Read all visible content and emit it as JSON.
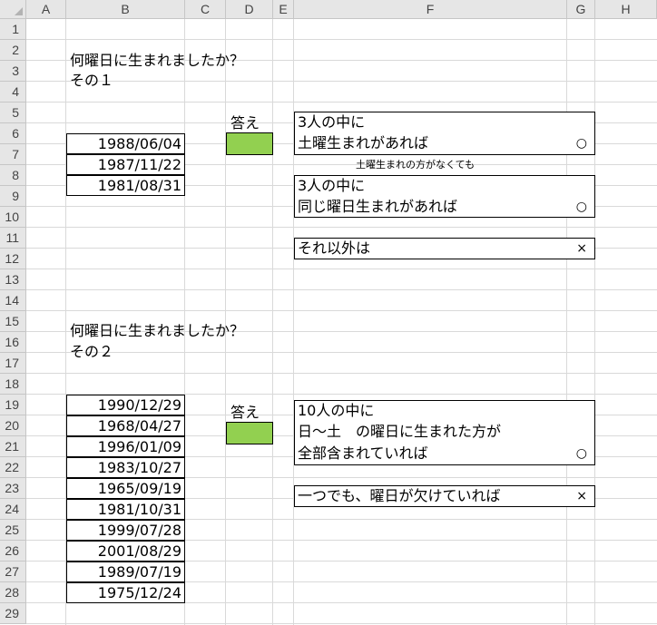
{
  "columns": [
    {
      "label": "A"
    },
    {
      "label": "B"
    },
    {
      "label": "C"
    },
    {
      "label": "D"
    },
    {
      "label": "E"
    },
    {
      "label": "F"
    },
    {
      "label": "G"
    },
    {
      "label": "H"
    }
  ],
  "rows": [
    "1",
    "2",
    "3",
    "4",
    "5",
    "6",
    "7",
    "8",
    "9",
    "10",
    "11",
    "12",
    "13",
    "14",
    "15",
    "16",
    "17",
    "18",
    "19",
    "20",
    "21",
    "22",
    "23",
    "24",
    "25",
    "26",
    "27",
    "28",
    "29"
  ],
  "section1": {
    "title": "何曜日に生まれましたか？",
    "subtitle": "その１",
    "answer_label": "答え",
    "dates": [
      "1988/06/04",
      "1987/11/22",
      "1981/08/31"
    ],
    "rule1": {
      "line1": "3人の中に",
      "line2": "土曜生まれがあれば",
      "mark": "○"
    },
    "note": "土曜生まれの方がなくても",
    "rule2": {
      "line1": "3人の中に",
      "line2": "同じ曜日生まれがあれば",
      "mark": "○"
    },
    "rule3": {
      "line1": "それ以外は",
      "mark": "×"
    }
  },
  "section2": {
    "title": "何曜日に生まれましたか？",
    "subtitle": "その２",
    "answer_label": "答え",
    "dates": [
      "1990/12/29",
      "1968/04/27",
      "1996/01/09",
      "1983/10/27",
      "1965/09/19",
      "1981/10/31",
      "1999/07/28",
      "2001/08/29",
      "1989/07/19",
      "1975/12/24"
    ],
    "rule1": {
      "line1": "10人の中に",
      "line2": "日～土　の曜日に生まれた方が",
      "line3": "全部含まれていれば",
      "mark": "○"
    },
    "rule2": {
      "line1": "一つでも、曜日が欠けていれば",
      "mark": "×"
    }
  }
}
